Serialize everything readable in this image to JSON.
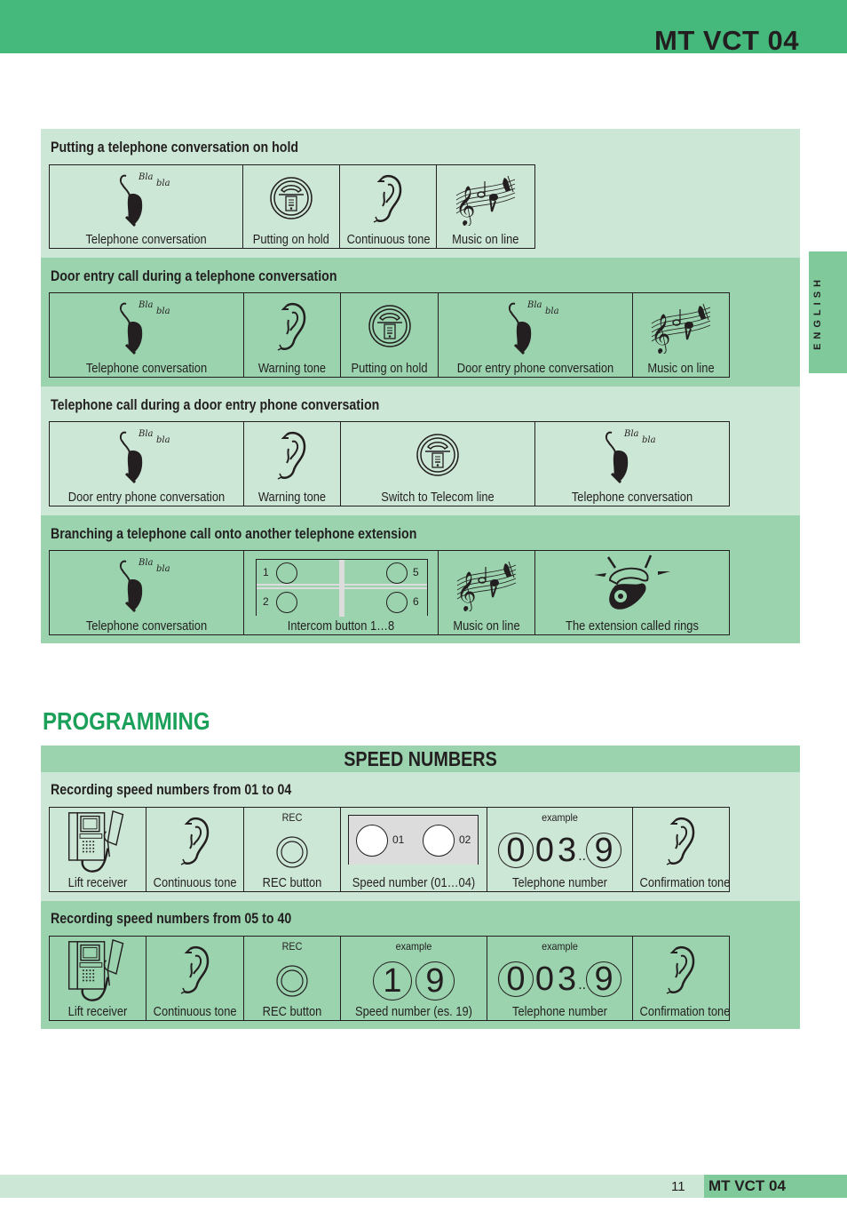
{
  "header": {
    "title": "MT VCT 04"
  },
  "language_tab": "ENGLISH",
  "colors": {
    "brand_green": "#45b97c",
    "light_band": "#cde7d6",
    "mid_band": "#9ad3ae",
    "heading_green": "#1ba05a"
  },
  "sections": [
    {
      "title": "Putting a telephone conversation on hold",
      "steps": [
        {
          "icon": "talking-handset-icon",
          "label": "Telephone conversation"
        },
        {
          "icon": "hold-button-icon",
          "label": "Putting on hold"
        },
        {
          "icon": "ear-icon",
          "label": "Continuous tone"
        },
        {
          "icon": "music-notes-icon",
          "label": "Music on line"
        }
      ]
    },
    {
      "title": "Door entry call during a telephone conversation",
      "steps": [
        {
          "icon": "talking-handset-icon",
          "label": "Telephone conversation"
        },
        {
          "icon": "ear-icon",
          "label": "Warning tone"
        },
        {
          "icon": "hold-button-icon",
          "label": "Putting on hold"
        },
        {
          "icon": "talking-handset-icon",
          "label": "Door entry phone conversation"
        },
        {
          "icon": "music-notes-icon",
          "label": "Music on line"
        }
      ]
    },
    {
      "title": "Telephone call during a door entry phone conversation",
      "steps": [
        {
          "icon": "talking-handset-icon",
          "label": "Door entry phone conversation"
        },
        {
          "icon": "ear-icon",
          "label": "Warning tone"
        },
        {
          "icon": "hold-button-icon",
          "label": "Switch to Telecom line"
        },
        {
          "icon": "talking-handset-icon",
          "label": "Telephone conversation"
        }
      ]
    },
    {
      "title": "Branching a telephone call onto another telephone extension",
      "steps": [
        {
          "icon": "talking-handset-icon",
          "label": "Telephone conversation"
        },
        {
          "icon": "intercom-buttons-icon",
          "label": "Intercom button 1…8",
          "buttons": [
            "1",
            "2",
            "5",
            "6"
          ]
        },
        {
          "icon": "music-notes-icon",
          "label": "Music on line"
        },
        {
          "icon": "ringing-phone-icon",
          "label": "The extension called rings"
        }
      ]
    }
  ],
  "programming": {
    "heading": "PROGRAMMING",
    "subheading": "SPEED NUMBERS",
    "procedures": [
      {
        "title": "Recording speed numbers from 01 to 04",
        "steps": [
          {
            "icon": "videophone-icon",
            "label": "Lift receiver"
          },
          {
            "icon": "ear-icon",
            "label": "Continuous tone"
          },
          {
            "icon": "rec-button-icon",
            "top": "REC",
            "label": "REC button"
          },
          {
            "icon": "speed-buttons-icon",
            "buttons": [
              "01",
              "02"
            ],
            "label": "Speed number (01…04)"
          },
          {
            "icon": "digits-icon",
            "top": "example",
            "digits": [
              "0",
              "0",
              "3",
              "..",
              "9"
            ],
            "label": "Telephone number"
          },
          {
            "icon": "ear-icon",
            "label": "Confirmation tone"
          }
        ]
      },
      {
        "title": "Recording speed numbers from 05 to 40",
        "steps": [
          {
            "icon": "videophone-icon",
            "label": "Lift receiver"
          },
          {
            "icon": "ear-icon",
            "label": "Continuous tone"
          },
          {
            "icon": "rec-button-icon",
            "top": "REC",
            "label": "REC button"
          },
          {
            "icon": "digits-icon",
            "top": "example",
            "digits": [
              "1",
              "9"
            ],
            "label": "Speed number (es. 19)"
          },
          {
            "icon": "digits-icon",
            "top": "example",
            "digits": [
              "0",
              "0",
              "3",
              "..",
              "9"
            ],
            "label": "Telephone number"
          },
          {
            "icon": "ear-icon",
            "label": "Confirmation tone"
          }
        ]
      }
    ]
  },
  "footer": {
    "page_number": "11",
    "title": "MT VCT 04"
  }
}
